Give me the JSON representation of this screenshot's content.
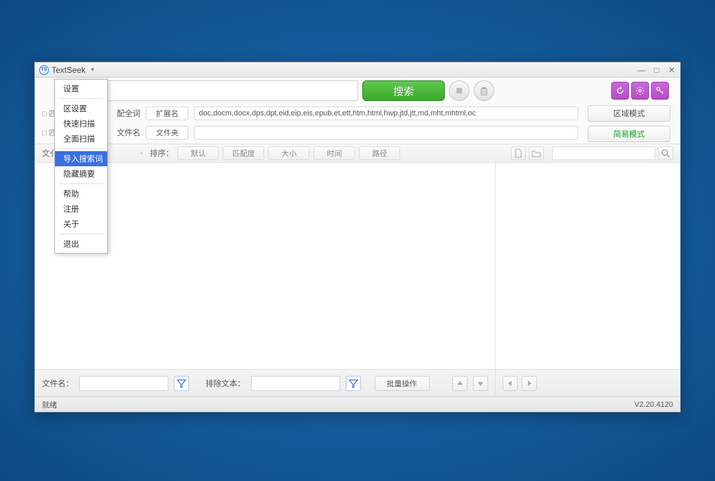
{
  "title": "TextSeek",
  "menu": {
    "items": [
      "设置",
      "区设置",
      "快速扫描",
      "全面扫描",
      "导入搜索词",
      "隐藏摘要",
      "帮助",
      "注册",
      "关于",
      "退出"
    ],
    "highlighted": "导入搜索词"
  },
  "toolbar": {
    "search_btn": "搜索"
  },
  "filters": {
    "row1_chk_prefix": "□ 匹",
    "row1_suffix": "配全词",
    "ext_label": "扩展名",
    "ext_value": "doc,docm,docx,dps,dpt,eid,eip,eis,epub,et,ett,htm,html,hwp,jtd,jtt,md,mht,mhtml,oc",
    "zone_mode": "区域模式",
    "row2_chk_prefix": "□ 匹",
    "row2_suffix": "文件名",
    "folder_label": "文件夹",
    "easy_mode": "简易模式"
  },
  "sort": {
    "file_prefix": "文亻",
    "sort_label": "排序：",
    "btns": [
      "默认",
      "匹配度",
      "大小",
      "时间",
      "路径"
    ]
  },
  "bottom": {
    "filename_label": "文件名：",
    "exclude_label": "排除文本：",
    "batch": "批量操作"
  },
  "status": {
    "ready": "就绪",
    "version": "V2.20.4120"
  }
}
